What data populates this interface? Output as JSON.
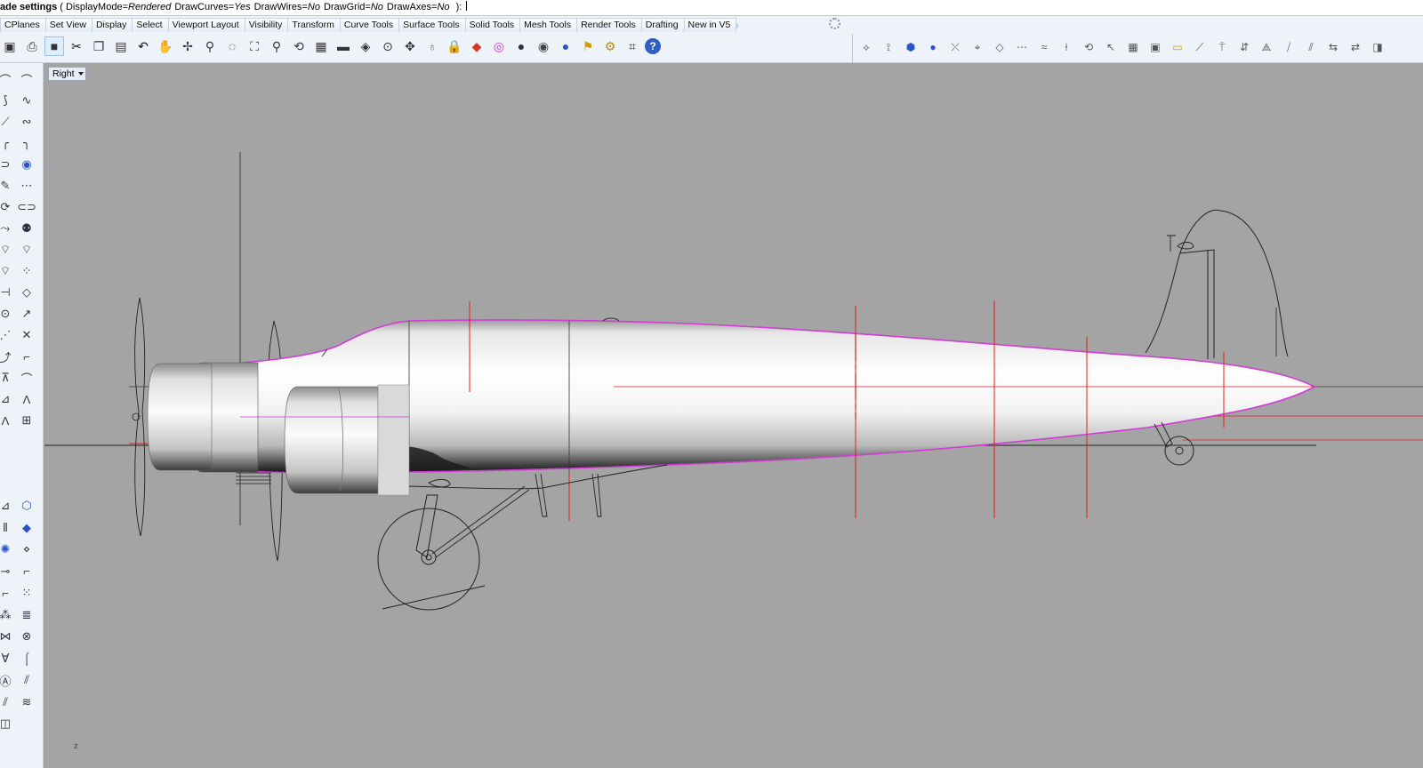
{
  "command_line": {
    "title": "ade settings",
    "open_paren": "(",
    "options": [
      {
        "name": "DisplayMode",
        "value": "Rendered"
      },
      {
        "name": "DrawCurves",
        "value": "Yes"
      },
      {
        "name": "DrawWires",
        "value": "No"
      },
      {
        "name": "DrawGrid",
        "value": "No"
      },
      {
        "name": "DrawAxes",
        "value": "No"
      }
    ],
    "close_paren": "):"
  },
  "tabs": [
    "CPlanes",
    "Set View",
    "Display",
    "Select",
    "Viewport Layout",
    "Visibility",
    "Transform",
    "Curve Tools",
    "Surface Tools",
    "Solid Tools",
    "Mesh Tools",
    "Render Tools",
    "Drafting",
    "New in V5"
  ],
  "main_toolbar_icons": [
    "save-icon",
    "print-icon",
    "select-window-icon",
    "cut-icon",
    "copy-icon",
    "paste-icon",
    "undo-icon",
    "pan-hand-icon",
    "rotate-view-icon",
    "zoom-dynamic-icon",
    "zoom-window-icon",
    "zoom-extents-icon",
    "zoom-selected-icon",
    "undo-view-icon",
    "four-viewports-icon",
    "named-views-icon",
    "set-cplane-icon",
    "cplane-origin-icon",
    "move-icon",
    "light-bulb-icon",
    "lock-icon",
    "layer-icon",
    "color-wheel-icon",
    "shade-sphere-icon",
    "rendered-sphere-icon",
    "render-icon",
    "pointer-flag-icon",
    "options-gear-icon",
    "snap-icon",
    "help-icon"
  ],
  "right_toolbar_icons": [
    "point-icon",
    "point-axis-icon",
    "sphere-point-icon",
    "sphere-icon",
    "curve-point-icon",
    "grid-snap-icon",
    "plane-icon",
    "control-points-icon",
    "rebuild-icon",
    "vertical-icon",
    "rotate-ccw-icon",
    "arrow-select-icon",
    "table-icon",
    "save-disk-icon",
    "folder-open-icon",
    "extrude-icon",
    "stand-icon",
    "flip-icon",
    "triangle-icon",
    "sweep-icon",
    "loft-icon",
    "double-arrow-icon",
    "arrow-both-icon",
    "box-edit-icon"
  ],
  "left_toolbar_icons": [
    "arc-icon",
    "arc-tangent-icon",
    "curve-blend-icon",
    "curve-interp-icon",
    "polyline-icon",
    "freeform-icon",
    "fillet-icon",
    "chamfer-icon",
    "offset-icon",
    "sphere-drop-icon",
    "pencil-icon",
    "line-icon",
    "rotate-icon",
    "cylinder-icon",
    "walk-icon",
    "people-icon",
    "fit-icon",
    "deg-icon",
    "fair-icon",
    "points-icon",
    "split-icon",
    "diamond-icon",
    "circle-points-icon",
    "arrow-line-icon",
    "dashed-line-icon",
    "delete-point-icon",
    "curve-node-icon",
    "hook-icon",
    "stretch-icon",
    "arc-dashed-icon",
    "surface-icon",
    "profile-icon",
    "a-frame-icon",
    "grid-icon",
    "edit-edge-icon",
    "box-icon",
    "mirror-icon",
    "diamond-fill-icon",
    "gear-surface-icon",
    "node-icon",
    "chain-icon",
    "stair-icon",
    "corner-icon",
    "dot-grid-icon",
    "scatter-icon",
    "ladder-icon",
    "cross-network-icon",
    "chain-mesh-icon",
    "text-icon",
    "bend-icon",
    "a-text-icon",
    "strip-icon",
    "slash-icon",
    "wave-icon",
    "surface-edit-icon"
  ],
  "viewport": {
    "name": "Right",
    "axis_label": "z"
  },
  "colors": {
    "viewport_bg": "#a4a4a4",
    "silhouette": "#d23cd6",
    "construction_red": "#e21e1e",
    "wire": "#1a1a1a"
  }
}
